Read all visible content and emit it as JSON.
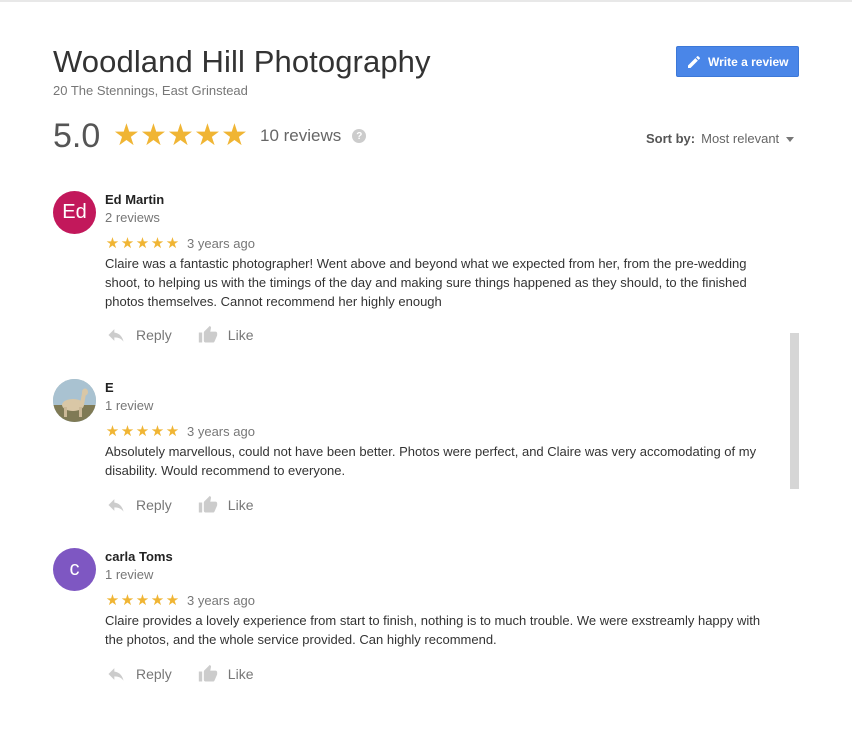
{
  "business": {
    "name": "Woodland Hill Photography",
    "address": "20 The Stennings, East Grinstead",
    "score": "5.0",
    "stars": 5,
    "review_count": "10 reviews",
    "help_icon": "?"
  },
  "actions": {
    "write_review": "Write a review",
    "write_icon": "pencil-icon"
  },
  "sort": {
    "label": "Sort by:",
    "value": "Most relevant"
  },
  "colors": {
    "star": "#f0b534",
    "button": "#4a86e8"
  },
  "reviews": [
    {
      "initials": "Ed",
      "avatar_color": "#c2185b",
      "name": "Ed Martin",
      "count": "2 reviews",
      "stars": 5,
      "age": "3 years ago",
      "text": "Claire was a fantastic photographer! Went above and beyond what we expected from her, from the pre-wedding shoot, to helping us with the timings of the day and making sure things happened as they should, to the finished photos themselves. Cannot recommend her highly enough",
      "reply": "Reply",
      "like": "Like"
    },
    {
      "initials": "",
      "avatar_color": "#8a9aa0",
      "avatar_image": "photo-of-animal",
      "name": "E",
      "count": "1 review",
      "stars": 5,
      "age": "3 years ago",
      "text": "Absolutely marvellous, could not have been better. Photos were perfect, and Claire was very accomodating of my disability. Would recommend to everyone.",
      "reply": "Reply",
      "like": "Like"
    },
    {
      "initials": "c",
      "avatar_color": "#7e57c2",
      "name": "carla Toms",
      "count": "1 review",
      "stars": 5,
      "age": "3 years ago",
      "text": "Claire provides a lovely experience from start to finish, nothing is to much trouble. We were exstreamly happy with the photos, and the whole service provided. Can highly recommend.",
      "reply": "Reply",
      "like": "Like"
    }
  ]
}
